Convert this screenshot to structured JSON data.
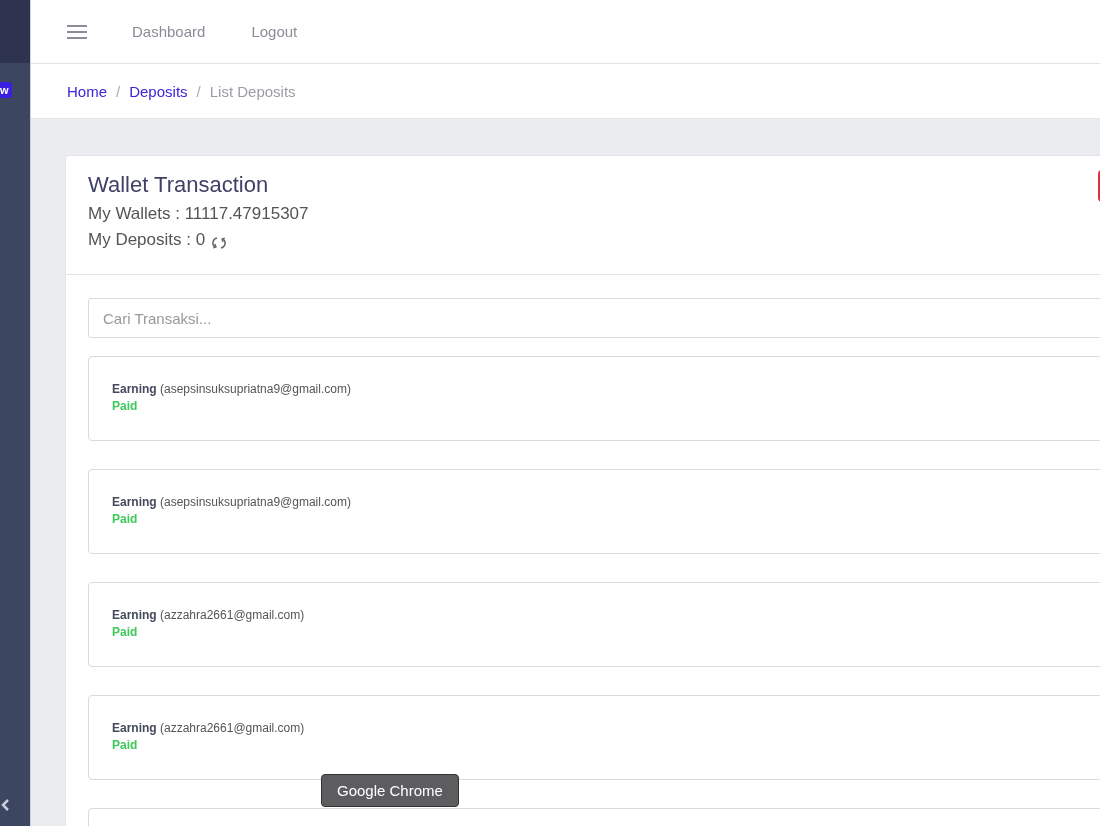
{
  "sidebar": {
    "badge": "w"
  },
  "top_nav": {
    "links": [
      "Dashboard",
      "Logout"
    ]
  },
  "breadcrumb": {
    "separator": "/",
    "items": [
      {
        "label": "Home",
        "link": true
      },
      {
        "label": "Deposits",
        "link": true
      },
      {
        "label": "List Deposits",
        "link": false
      }
    ]
  },
  "card": {
    "title": "Wallet Transaction",
    "wallets": "My Wallets : 11117.47915307",
    "deposits": "My Deposits : 0"
  },
  "search": {
    "placeholder": "Cari Transaksi..."
  },
  "transactions": [
    {
      "kind": "entry",
      "type": "Earning",
      "email": "(asepsinsuksupriatna9@gmail.com)",
      "status": "Paid"
    },
    {
      "kind": "entry",
      "type": "Earning",
      "email": "(asepsinsuksupriatna9@gmail.com)",
      "status": "Paid"
    },
    {
      "kind": "entry",
      "type": "Earning",
      "email": "(azzahra2661@gmail.com)",
      "status": "Paid"
    },
    {
      "kind": "entry",
      "type": "Earning",
      "email": "(azzahra2661@gmail.com)",
      "status": "Paid"
    },
    {
      "kind": "empty"
    }
  ],
  "tooltip": "Google Chrome"
}
